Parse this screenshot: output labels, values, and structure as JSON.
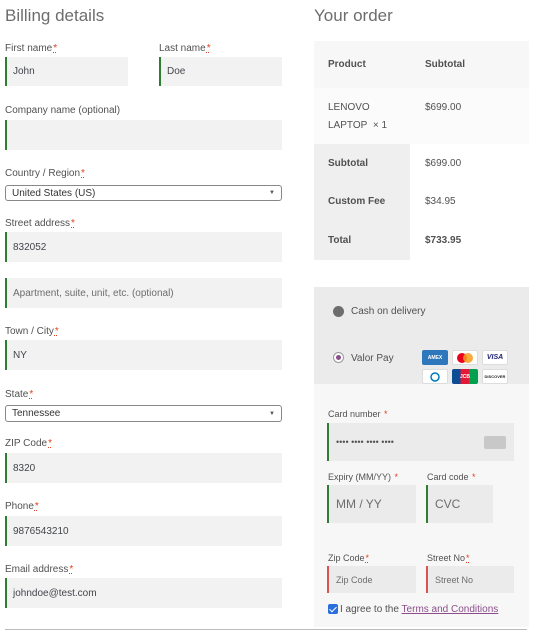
{
  "billing": {
    "heading": "Billing details",
    "required_mark": "*",
    "first_name": {
      "label": "First name",
      "value": "John"
    },
    "last_name": {
      "label": "Last name",
      "value": "Doe"
    },
    "company": {
      "label": "Company name (optional)",
      "value": ""
    },
    "country": {
      "label": "Country / Region",
      "value": "United States (US)"
    },
    "street": {
      "label": "Street address",
      "value": "832052",
      "placeholder2": "Apartment, suite, unit, etc. (optional)"
    },
    "town": {
      "label": "Town / City",
      "value": "NY"
    },
    "state": {
      "label": "State",
      "value": "Tennessee"
    },
    "zip": {
      "label": "ZIP Code",
      "value": "8320"
    },
    "phone": {
      "label": "Phone",
      "value": "9876543210"
    },
    "email": {
      "label": "Email address",
      "value": "johndoe@test.com"
    }
  },
  "order": {
    "heading": "Your order",
    "col_product": "Product",
    "col_subtotal": "Subtotal",
    "item_name_line1": "LENOVO",
    "item_name_line2": "LAPTOP",
    "item_qty": "× 1",
    "item_price": "$699.00",
    "subtotal_label": "Subtotal",
    "subtotal_value": "$699.00",
    "fee_label": "Custom Fee",
    "fee_value": "$34.95",
    "total_label": "Total",
    "total_value": "$733.95"
  },
  "payment": {
    "cod_label": "Cash on delivery",
    "valor_label": "Valor Pay",
    "cards": [
      "AMEX",
      "MC",
      "VISA",
      "DC",
      "JCB",
      "DISCOVER"
    ],
    "card_number_label": "Card number",
    "card_number_placeholder": "•••• •••• •••• ••••",
    "expiry_label": "Expiry (MM/YY)",
    "expiry_placeholder": "MM / YY",
    "cvc_label": "Card code",
    "cvc_placeholder": "CVC",
    "zip_label": "Zip Code",
    "zip_placeholder": "Zip Code",
    "street_label": "Street No",
    "street_placeholder": "Street No",
    "terms_prefix": "I agree to the",
    "terms_link": "Terms and Conditions"
  },
  "colors": {
    "accent_green": "#2e7d32",
    "accent_purple": "#8b4e8a",
    "required_red": "#e2401c"
  }
}
